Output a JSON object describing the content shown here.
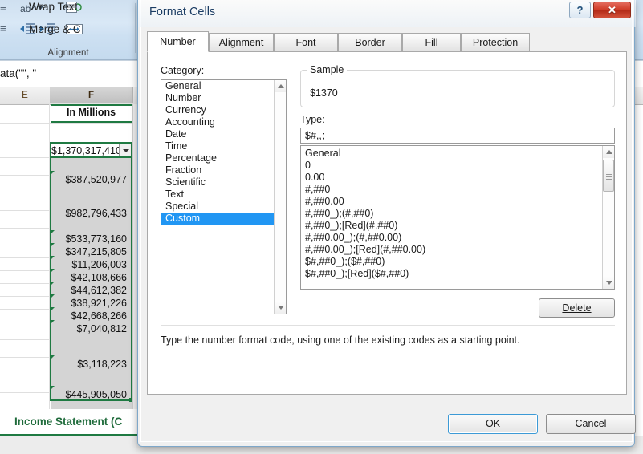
{
  "background": {
    "ribbon": {
      "group_label": "Alignment",
      "wrap_text_label": "Wrap Text",
      "merge_label": "Merge & C",
      "icons": [
        "align-top-icon",
        "orientation-icon",
        "decrease-indent-icon",
        "increase-indent-icon",
        "wrap-text-icon",
        "merge-center-icon"
      ]
    },
    "formula_bar": {
      "value": "ata(\"\", \""
    },
    "column_headers": [
      "E",
      "F"
    ],
    "selected_column": "F",
    "grid": {
      "header_cell": "In Millions",
      "active_cell_value": "$1,370,317,410",
      "cells": [
        "$387,520,977",
        "$982,796,433",
        "$533,773,160",
        "$347,215,805",
        "$11,206,003",
        "$42,108,666",
        "$44,612,382",
        "$38,921,226",
        "$42,668,266",
        "$7,040,812",
        "$3,118,223",
        "$445,905,050"
      ]
    },
    "sheet_tab": "Income Statement (C"
  },
  "dialog": {
    "title": "Format Cells",
    "help_button": "?",
    "close_button": "✕",
    "tabs": [
      {
        "label": "Number",
        "active": true
      },
      {
        "label": "Alignment",
        "active": false
      },
      {
        "label": "Font",
        "active": false
      },
      {
        "label": "Border",
        "active": false
      },
      {
        "label": "Fill",
        "active": false
      },
      {
        "label": "Protection",
        "active": false
      }
    ],
    "category": {
      "label": "Category:",
      "items": [
        "General",
        "Number",
        "Currency",
        "Accounting",
        "Date",
        "Time",
        "Percentage",
        "Fraction",
        "Scientific",
        "Text",
        "Special",
        "Custom"
      ],
      "selected": "Custom"
    },
    "sample": {
      "group_title": "Sample",
      "value": "$1370"
    },
    "type": {
      "label": "Type:",
      "value": "$#,,;",
      "items": [
        "General",
        "0",
        "0.00",
        "#,##0",
        "#,##0.00",
        "#,##0_);(#,##0)",
        "#,##0_);[Red](#,##0)",
        "#,##0.00_);(#,##0.00)",
        "#,##0.00_);[Red](#,##0.00)",
        "$#,##0_);($#,##0)",
        "$#,##0_);[Red]($#,##0)"
      ]
    },
    "delete_button": "Delete",
    "hint": "Type the number format code, using one of the existing codes as a starting point.",
    "ok_button": "OK",
    "cancel_button": "Cancel"
  },
  "colors": {
    "accent_blue": "#2196f3",
    "excel_green": "#1f7a42",
    "close_red": "#cf3b27",
    "title_text": "#1b3c63"
  }
}
